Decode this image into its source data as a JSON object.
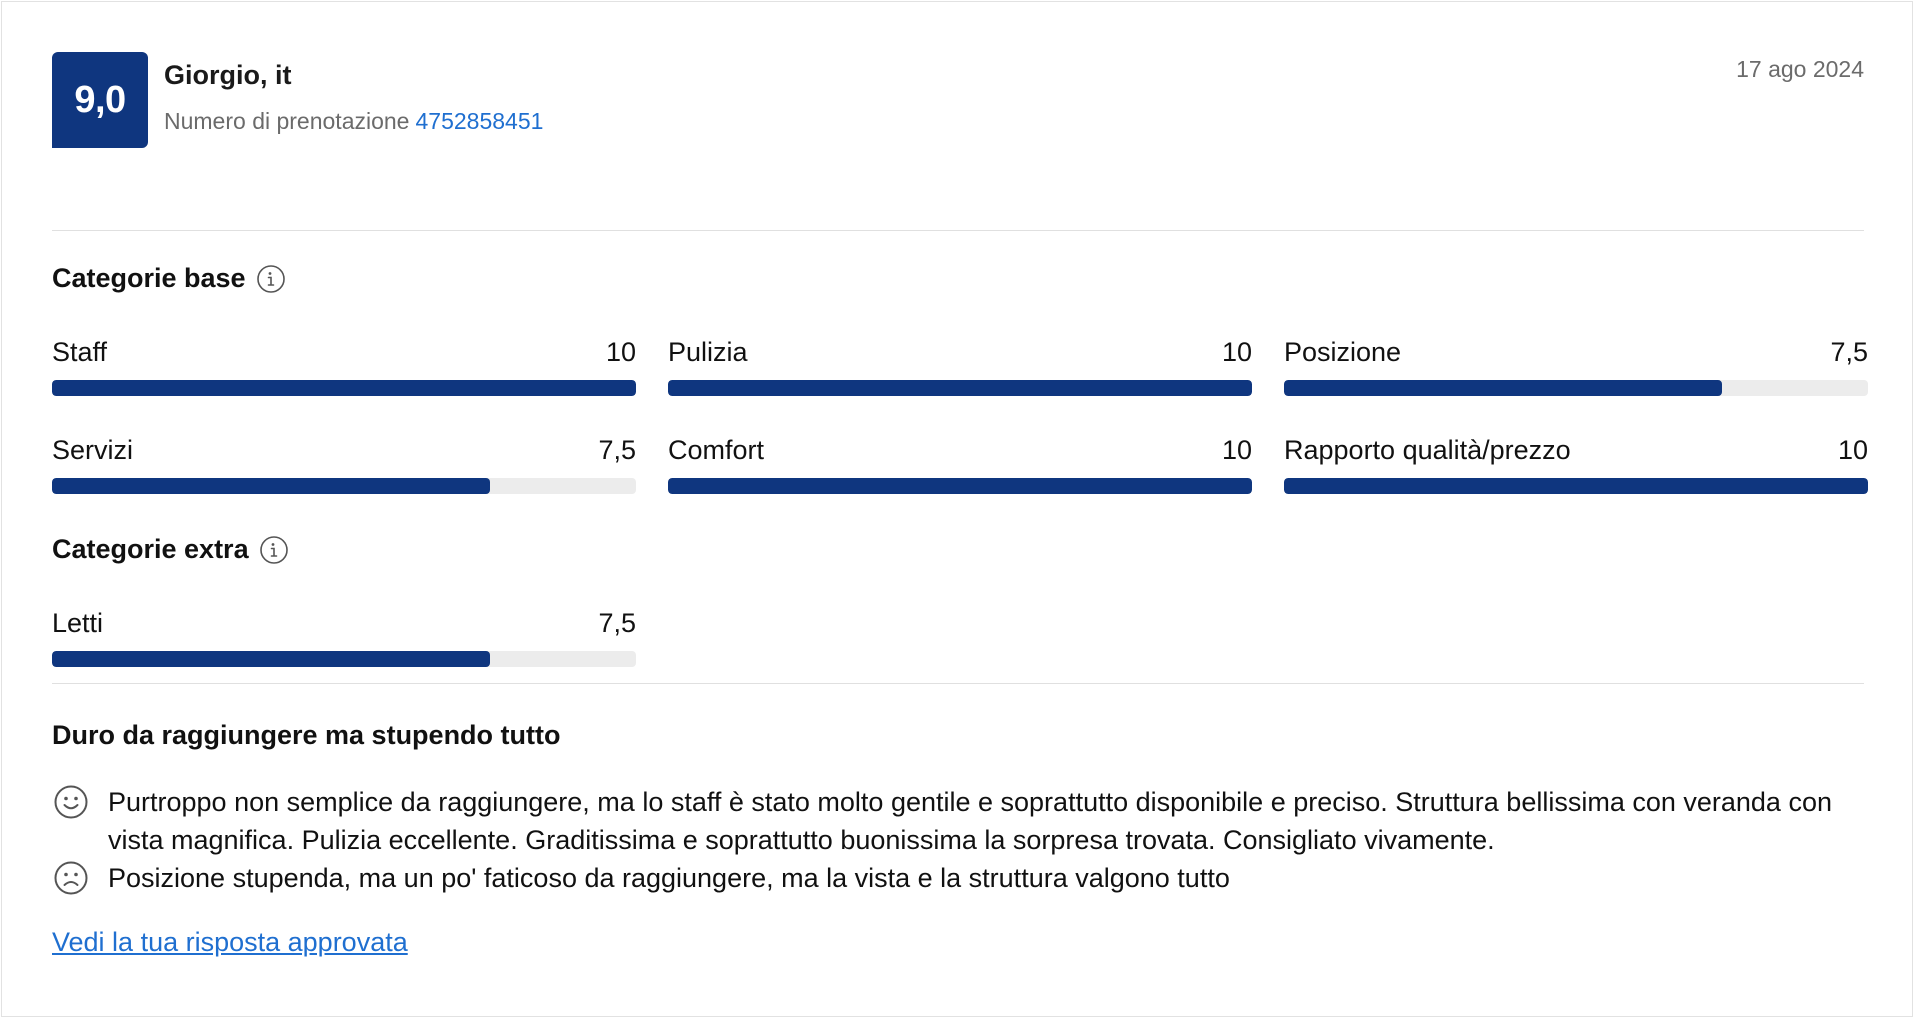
{
  "header": {
    "score": "9,0",
    "reviewer": "Giorgio, it",
    "booking_label": "Numero di prenotazione",
    "booking_number": "4752858451",
    "date": "17 ago 2024"
  },
  "base_section": {
    "title": "Categorie base",
    "categories": [
      {
        "label": "Staff",
        "score": "10",
        "value": 10
      },
      {
        "label": "Pulizia",
        "score": "10",
        "value": 10
      },
      {
        "label": "Posizione",
        "score": "7,5",
        "value": 7.5
      },
      {
        "label": "Servizi",
        "score": "7,5",
        "value": 7.5
      },
      {
        "label": "Comfort",
        "score": "10",
        "value": 10
      },
      {
        "label": "Rapporto qualità/prezzo",
        "score": "10",
        "value": 10
      }
    ]
  },
  "extra_section": {
    "title": "Categorie extra",
    "categories": [
      {
        "label": "Letti",
        "score": "7,5",
        "value": 7.5
      }
    ]
  },
  "review": {
    "title": "Duro da raggiungere ma stupendo tutto",
    "positive_icon": "smile-icon",
    "positive": "Purtroppo non semplice da raggiungere, ma lo staff è stato molto gentile e soprattutto disponibile e preciso. Struttura bellissima con veranda con vista magnifica. Pulizia eccellente. Graditissima e soprattutto buonissima la sorpresa trovata. Consigliato vivamente.",
    "negative_icon": "frown-icon",
    "negative": "Posizione stupenda, ma un po' faticoso da raggiungere, ma la vista e la struttura valgono tutto",
    "response_link": "Vedi la tua risposta approvata"
  },
  "colors": {
    "brand": "#0f367f",
    "link": "#1f6fd0",
    "bar_track": "#ececec"
  },
  "scale_max": 10
}
